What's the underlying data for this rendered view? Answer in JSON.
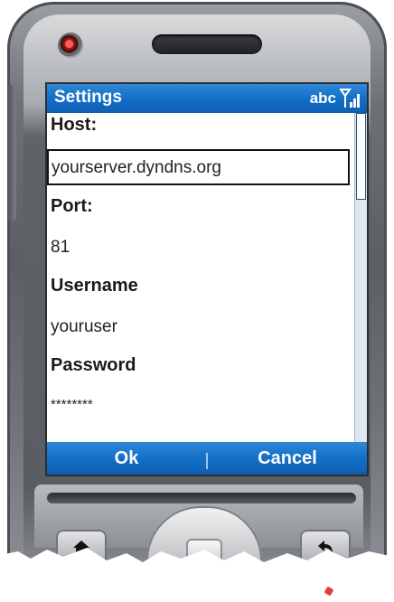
{
  "titlebar": {
    "title": "Settings",
    "input_mode": "abc",
    "signal_icon": "signal-strength-icon"
  },
  "form": {
    "host_label": "Host:",
    "host_value": "yourserver.dyndns.org",
    "port_label": "Port:",
    "port_value": "81",
    "username_label": "Username",
    "username_value": "youruser",
    "password_label": "Password",
    "password_value": "********"
  },
  "softkeys": {
    "left": "Ok",
    "right": "Cancel"
  },
  "colors": {
    "titlebar": "#1470c8",
    "softbar": "#1470c8",
    "text": "#1a1a1a"
  },
  "hardware": {
    "home_key_icon": "home-icon",
    "back_key_icon": "back-arrow-icon"
  }
}
